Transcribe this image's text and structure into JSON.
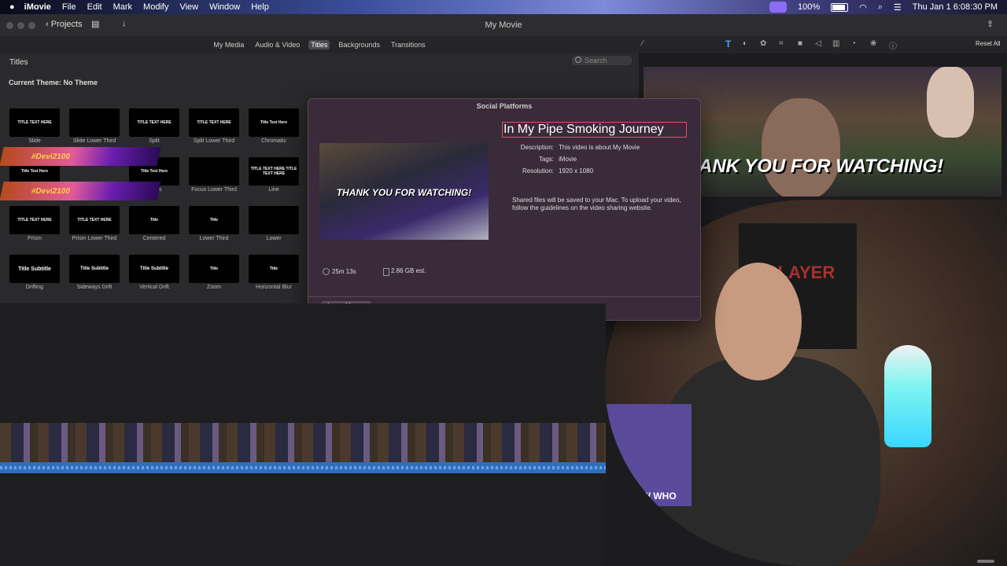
{
  "menubar": {
    "app": "iMovie",
    "items": [
      "File",
      "Edit",
      "Mark",
      "Modify",
      "View",
      "Window",
      "Help"
    ],
    "battery": "100%",
    "datetime": "Thu Jan 1  6:08:30 PM"
  },
  "window": {
    "title": "My Movie",
    "projects_label": "Projects"
  },
  "browser": {
    "tabs": [
      "My Media",
      "Audio & Video",
      "Titles",
      "Backgrounds",
      "Transitions"
    ],
    "active_tab": "Titles",
    "section_title": "Titles",
    "search_placeholder": "Search",
    "theme": "Current Theme: No Theme"
  },
  "inspector": {
    "reset_all": "Reset All"
  },
  "titles": {
    "row1": [
      {
        "thumb": "TITLE TEXT HERE",
        "label": "Slide"
      },
      {
        "thumb": "",
        "label": "Slide Lower Third"
      },
      {
        "thumb": "TITLE TEXT HERE",
        "label": "Split"
      },
      {
        "thumb": "TITLE TEXT HERE",
        "label": "Split Lower Third"
      },
      {
        "thumb": "Title Text Here",
        "label": "Chromatic"
      }
    ],
    "row2": [
      {
        "thumb": "Title Text Here",
        "label": ""
      },
      {
        "thumb": "Title Text Here",
        "label": "Focus"
      },
      {
        "thumb": "",
        "label": "Focus Lower Third"
      },
      {
        "thumb": "TITLE TEXT HERE TITLE TEXT HERE",
        "label": "Line"
      }
    ],
    "row3": [
      {
        "thumb": "TITLE TEXT HERE",
        "label": "Prism"
      },
      {
        "thumb": "TITLE TEXT HERE",
        "label": "Prism Lower Third"
      },
      {
        "thumb": "Title",
        "label": "Centered"
      },
      {
        "thumb": "Title",
        "label": "Lower Third"
      },
      {
        "thumb": "",
        "label": "Lower"
      }
    ],
    "row4": [
      {
        "thumb": "Title Subtitle",
        "label": "Drifting"
      },
      {
        "thumb": "Title Subtitle",
        "label": "Sideways Drift"
      },
      {
        "thumb": "Title Subtitle",
        "label": "Vertical Drift"
      },
      {
        "thumb": "Title",
        "label": "Zoom"
      },
      {
        "thumb": "Title",
        "label": "Horizontal Blur"
      }
    ],
    "banner": "#Devi2100"
  },
  "dialog": {
    "title": "Social Platforms",
    "movie_title": "In My Pipe Smoking Journey",
    "thumb_text": "THANK YOU FOR WATCHING!",
    "description_label": "Description:",
    "description": "This video is about My Movie",
    "tags_label": "Tags:",
    "tags": "iMovie",
    "resolution_label": "Resolution:",
    "resolution": "1920 x 1080",
    "info": "Shared files will be saved to your Mac. To upload your video, follow the guidelines on the video sharing website.",
    "duration": "25m 13s",
    "size": "2.86 GB est.",
    "learn_more": "Learn More..."
  },
  "viewer": {
    "overlay_text": "ANK YOU FOR WATCHING!"
  },
  "webcam": {
    "flag_text": "SLAYER",
    "box_text": "U KNOW WHO"
  }
}
